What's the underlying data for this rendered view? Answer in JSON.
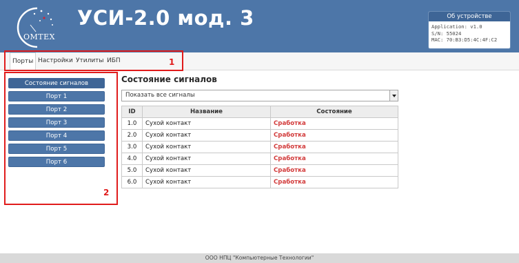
{
  "header": {
    "title": "УСИ-2.0 мод. 3",
    "logo_text": "OMTEX"
  },
  "device_info": {
    "title": "Об устройстве",
    "application": "Application: v1.0",
    "serial": "S/N: 55024",
    "mac": "MAC: 70:B3:D5:4C:4F:C2"
  },
  "menu": {
    "items": [
      {
        "label": "Порты",
        "active": true
      },
      {
        "label": "Настройки"
      },
      {
        "label": "Утилиты"
      },
      {
        "label": "ИБП"
      }
    ]
  },
  "annotations": {
    "label_1": "1",
    "label_2": "2"
  },
  "sidebar": {
    "items": [
      {
        "label": "Состояние сигналов",
        "active": true
      },
      {
        "label": "Порт 1"
      },
      {
        "label": "Порт 2"
      },
      {
        "label": "Порт 3"
      },
      {
        "label": "Порт 4"
      },
      {
        "label": "Порт 5"
      },
      {
        "label": "Порт 6"
      }
    ]
  },
  "main": {
    "title": "Состояние сигналов",
    "filter": {
      "selected": "Показать все сигналы"
    },
    "table": {
      "headers": [
        "ID",
        "Название",
        "Состояние"
      ],
      "rows": [
        {
          "id": "1.0",
          "name": "Сухой контакт",
          "state": "Сработка"
        },
        {
          "id": "2.0",
          "name": "Сухой контакт",
          "state": "Сработка"
        },
        {
          "id": "3.0",
          "name": "Сухой контакт",
          "state": "Сработка"
        },
        {
          "id": "4.0",
          "name": "Сухой контакт",
          "state": "Сработка"
        },
        {
          "id": "5.0",
          "name": "Сухой контакт",
          "state": "Сработка"
        },
        {
          "id": "6.0",
          "name": "Сухой контакт",
          "state": "Сработка"
        }
      ]
    }
  },
  "footer": {
    "text": "ООО НПЦ \"Компьютерные Технологии\""
  },
  "colors": {
    "header_bg": "#4d76a8",
    "accent_dark": "#3e6596",
    "state_alarm": "#d23a3a",
    "annotation": "#e01b1b"
  }
}
